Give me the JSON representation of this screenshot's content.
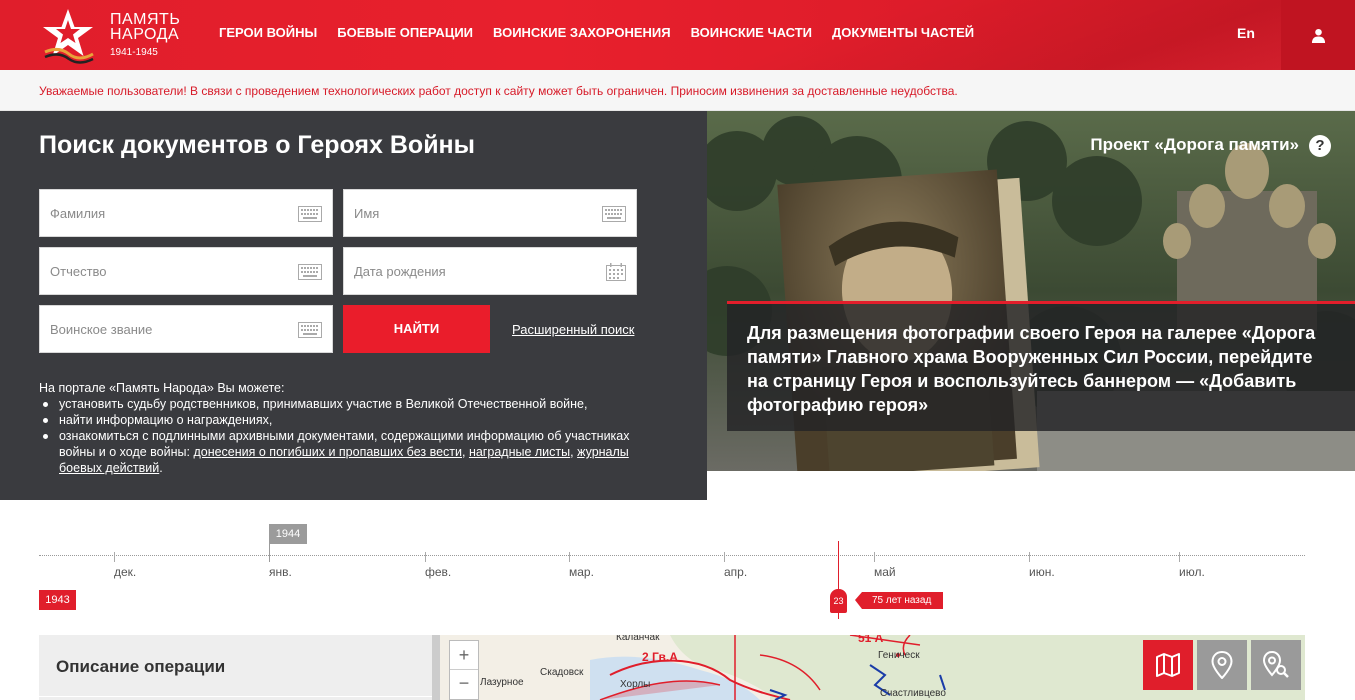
{
  "header": {
    "logo": {
      "title_line1": "ПАМЯТЬ",
      "title_line2": "НАРОДА",
      "years": "1941-1945"
    },
    "nav": [
      "ГЕРОИ ВОЙНЫ",
      "БОЕВЫЕ ОПЕРАЦИИ",
      "ВОИНСКИЕ ЗАХОРОНЕНИЯ",
      "ВОИНСКИЕ ЧАСТИ",
      "ДОКУМЕНТЫ ЧАСТЕЙ"
    ],
    "lang": "En",
    "user_icon": "user-icon"
  },
  "alert": {
    "text": "Уважаемые пользователи! В связи с проведением технологических работ доступ к сайту может быть ограничен. Приносим извинения за доставленные неудобства."
  },
  "search": {
    "title": "Поиск документов о Героях Войны",
    "fields": {
      "surname": {
        "placeholder": "Фамилия",
        "value": ""
      },
      "name": {
        "placeholder": "Имя",
        "value": ""
      },
      "patronymic": {
        "placeholder": "Отчество",
        "value": ""
      },
      "birthdate": {
        "placeholder": "Дата рождения",
        "value": ""
      },
      "rank": {
        "placeholder": "Воинское звание",
        "value": ""
      }
    },
    "find_button": "НАЙТИ",
    "advanced_link": "Расширенный поиск",
    "info": {
      "intro": "На портале «Память Народа» Вы можете:",
      "item1": "установить судьбу родственников, принимавших участие в Великой Отечественной войне,",
      "item2": "найти информацию о награждениях,",
      "item3_text": "ознакомиться с подлинными архивными документами, содержащими информацию об участниках войны и о ходе войны: ",
      "link1": "донесения о погибших и пропавших без вести",
      "sep1": ", ",
      "link2": "наградные листы",
      "sep2": ", ",
      "link3": "журналы боевых действий",
      "end": "."
    }
  },
  "promo": {
    "title": "Проект «Дорога памяти»",
    "help": "?",
    "text": "Для размещения фотографии своего Героя на галерее «Дорога памяти» Главного храма Вооруженных Сил России, перейдите на страницу Героя и воспользуйтесь баннером — «Добавить фотографию героя»"
  },
  "timeline": {
    "year_top": "1944",
    "year_left": "1943",
    "months": [
      "дек.",
      "янв.",
      "фев.",
      "мар.",
      "апр.",
      "май",
      "июн.",
      "июл."
    ],
    "marker_day": "23",
    "marker_ago": "75 лет назад"
  },
  "operation": {
    "title": "Описание операции"
  },
  "map": {
    "zoom_in": "+",
    "zoom_out": "−",
    "labels": [
      "Каланчак",
      "Скадовск",
      "Хорлы",
      "Лазурное",
      "Геническ",
      "Счастливцево"
    ],
    "units": [
      "2 Гв.А",
      "51 А"
    ],
    "tools": [
      "map-icon",
      "location-pin-icon",
      "location-search-icon"
    ]
  },
  "colors": {
    "brand_red": "#e01e2b",
    "panel_dark": "#3a3b3f",
    "alert_text": "#d71a28"
  }
}
